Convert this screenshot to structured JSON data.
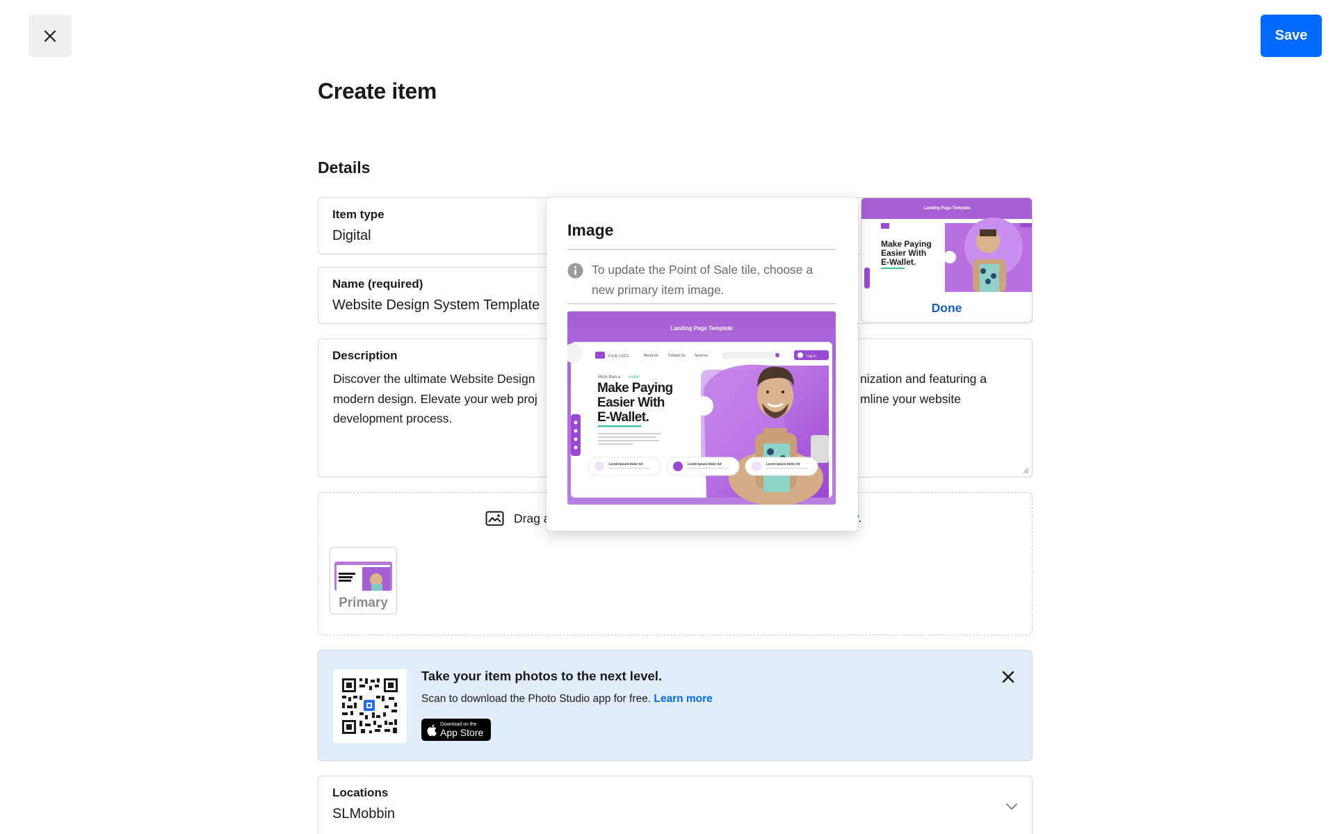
{
  "header": {
    "close_icon": "close-icon",
    "save_label": "Save"
  },
  "page": {
    "title": "Create item",
    "section_title": "Details"
  },
  "fields": {
    "item_type": {
      "label": "Item type",
      "value": "Digital"
    },
    "name": {
      "label": "Name (required)",
      "value": "Website Design System Template"
    },
    "description": {
      "label": "Description",
      "visible_lines": [
        [
          "Discover the ultimate Website Design",
          "nization and featuring a"
        ],
        [
          "modern design. Elevate your web proj",
          "mline your website"
        ],
        [
          "development process.",
          ""
        ]
      ]
    }
  },
  "dropzone": {
    "icon": "image-icon",
    "text": "Drag a",
    "link_tail": "y",
    "after_link": ".",
    "thumb_label": "Primary"
  },
  "banner": {
    "title": "Take your item photos to the next level.",
    "subtitle": "Scan to download the Photo Studio app for free.",
    "link": "Learn more",
    "appstore_small": "Download on the",
    "appstore_big": "App Store",
    "close_icon": "close-icon"
  },
  "locations": {
    "label": "Locations",
    "value": "SLMobbin",
    "icon": "chevron-down-icon"
  },
  "image_popover": {
    "title": "Image",
    "info_icon": "info-icon",
    "info_text": "To update the Point of Sale tile, choose a new primary item image.",
    "preview": {
      "banner_title": "Landing Page Template",
      "logo": "YOUR LOGO",
      "nav": [
        "About Us",
        "Contact Us",
        "Services"
      ],
      "login": "Log In",
      "kicker": "More than a",
      "kicker_accent": "wallet",
      "headline": [
        "Make Paying",
        "Easier With",
        "E-Wallet."
      ],
      "cards": [
        "Lorem Ipsum Dolor Sit",
        "Lorem Ipsum Dolor Sit",
        "Lorem Ipsum Dolor Sit"
      ]
    }
  },
  "done_card": {
    "label": "Done"
  },
  "colors": {
    "accent": "#006aff",
    "link_dark": "#1a5fb4",
    "banner_bg": "#e1edfb",
    "preview_purple": "#a45fd0"
  }
}
